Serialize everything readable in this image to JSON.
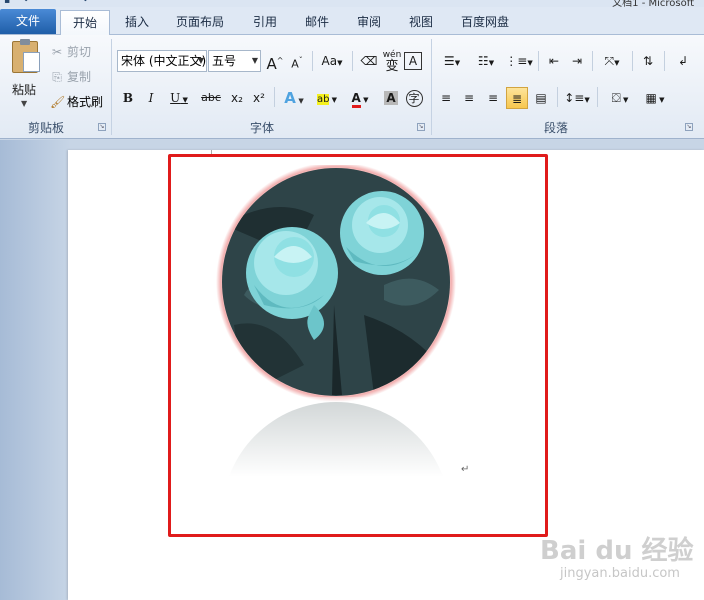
{
  "window": {
    "title_fragment": "文档1 - Microsoft"
  },
  "tabs": [
    {
      "label": "文件"
    },
    {
      "label": "开始"
    },
    {
      "label": "插入"
    },
    {
      "label": "页面布局"
    },
    {
      "label": "引用"
    },
    {
      "label": "邮件"
    },
    {
      "label": "审阅"
    },
    {
      "label": "视图"
    },
    {
      "label": "百度网盘"
    }
  ],
  "clipboard": {
    "group_label": "剪贴板",
    "paste_label": "粘贴",
    "cut_label": "剪切",
    "copy_label": "复制",
    "format_painter_label": "格式刷"
  },
  "font": {
    "group_label": "字体",
    "font_name": "宋体 (中文正文)",
    "font_size": "五号",
    "grow": "A",
    "shrink": "A",
    "change_case": "Aa",
    "bold": "B",
    "italic": "I",
    "underline": "U",
    "strike": "abc",
    "subscript": "x₂",
    "superscript": "x²",
    "text_effect": "A",
    "highlight": "ab",
    "font_color": "A",
    "char_shading": "A",
    "enclose": "字",
    "pinyin": "wén",
    "char_border": "A"
  },
  "paragraph": {
    "group_label": "段落"
  },
  "document": {
    "paragraph_mark": "↵"
  },
  "watermark": {
    "brand": "Bai du 经验",
    "url": "jingyan.baidu.com"
  },
  "colors": {
    "accent_blue": "#1f5ea8",
    "selection_red": "#e01b1b",
    "rose_cyan": "#8fe0e3",
    "circle_dark": "#2e4448",
    "glow_pink": "#f0a6a6"
  }
}
